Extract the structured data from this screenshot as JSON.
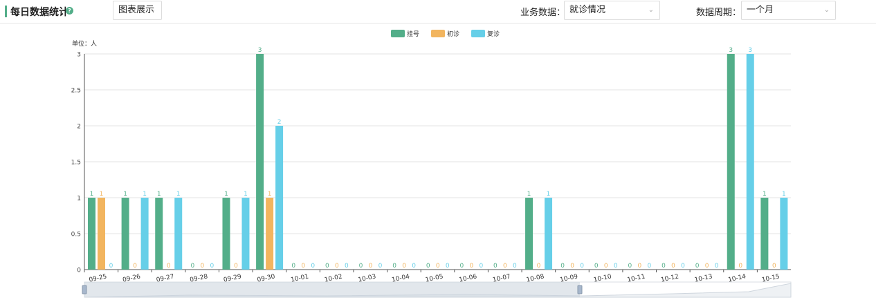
{
  "header": {
    "title": "每日数据统计",
    "help_icon": "?",
    "view_select": {
      "value": "图表展示"
    },
    "business_label": "业务数据：",
    "business_select": {
      "value": "就诊情况"
    },
    "period_label": "数据周期：",
    "period_select": {
      "value": "一个月"
    }
  },
  "colors": {
    "accent": "#53ae89",
    "s1": "#53ae89",
    "s2": "#f2b55f",
    "s3": "#66cfe8"
  },
  "chart_data": {
    "type": "bar",
    "unit_label": "单位：人",
    "categories": [
      "09-25",
      "09-26",
      "09-27",
      "09-28",
      "09-29",
      "09-30",
      "10-01",
      "10-02",
      "10-03",
      "10-04",
      "10-05",
      "10-06",
      "10-07",
      "10-08",
      "10-09",
      "10-10",
      "10-11",
      "10-12",
      "10-13",
      "10-14",
      "10-15"
    ],
    "series": [
      {
        "name": "挂号",
        "color": "#53ae89",
        "values": [
          1,
          1,
          1,
          0,
          1,
          3,
          0,
          0,
          0,
          0,
          0,
          0,
          0,
          1,
          0,
          0,
          0,
          0,
          0,
          3,
          1
        ]
      },
      {
        "name": "初诊",
        "color": "#f2b55f",
        "values": [
          1,
          0,
          0,
          0,
          0,
          1,
          0,
          0,
          0,
          0,
          0,
          0,
          0,
          0,
          0,
          0,
          0,
          0,
          0,
          0,
          0
        ]
      },
      {
        "name": "复诊",
        "color": "#66cfe8",
        "values": [
          0,
          1,
          1,
          0,
          1,
          2,
          0,
          0,
          0,
          0,
          0,
          0,
          0,
          1,
          0,
          0,
          0,
          0,
          0,
          3,
          1
        ]
      }
    ],
    "ylim": [
      0,
      3
    ],
    "yticks": [
      "0",
      "0.5",
      "1",
      "1.5",
      "2",
      "2.5",
      "3"
    ],
    "grid": true,
    "legend": "top-center"
  }
}
